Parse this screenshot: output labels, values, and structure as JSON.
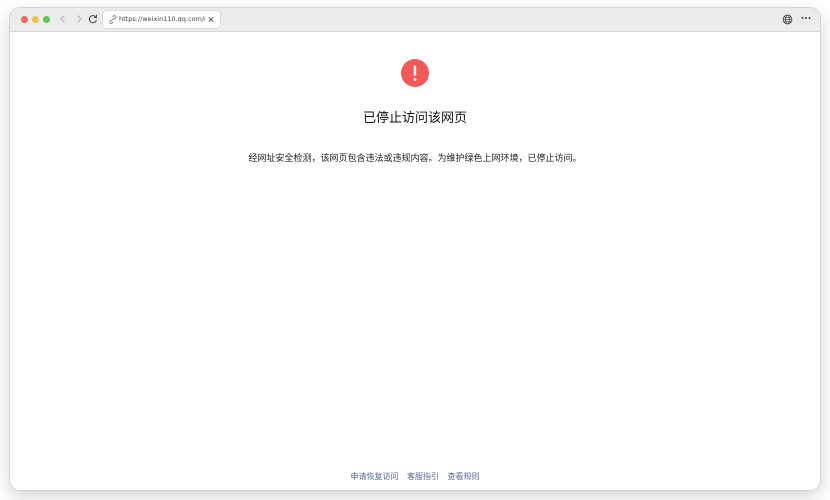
{
  "browser": {
    "tab": {
      "url": "https://weixin110.qq.com/cg"
    },
    "icons": {
      "back": "chevron-left-icon",
      "forward": "chevron-right-icon",
      "reload": "reload-icon",
      "tab_link": "link-icon",
      "tab_close": "close-icon",
      "globe": "globe-icon",
      "more": "more-icon"
    }
  },
  "page": {
    "headline": "已停止访问该网页",
    "description": "经网址安全检测，该网页包含违法或违规内容。为维护绿色上网环境，已停止访问。",
    "warning_color": "#f05a5a",
    "footer_links": [
      {
        "label": "申请恢复访问"
      },
      {
        "label": "客服指引"
      },
      {
        "label": "查看规则"
      }
    ],
    "link_color": "#576b95"
  }
}
